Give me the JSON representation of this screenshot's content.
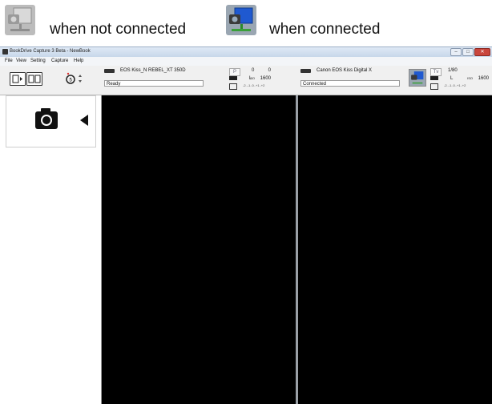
{
  "legend": {
    "not_connected": {
      "icon": "camera-not-connected-icon",
      "label": "when not connected"
    },
    "connected": {
      "icon": "camera-connected-icon",
      "label": "when connected"
    }
  },
  "window": {
    "title": "BookDrive Capture 3 Beta - NewBook",
    "buttons": {
      "minimize": "–",
      "maximize": "□",
      "close": "✕"
    }
  },
  "menu": [
    "File",
    "View",
    "Setting",
    "Capture",
    "Help"
  ],
  "cameras": [
    {
      "name": "EOS Kiss_N REBEL_XT 350D",
      "status": "Ready",
      "mode": "P",
      "value1": "0",
      "value2": "0",
      "quality": "L",
      "iso_label": "ISO",
      "iso": "1600",
      "scale": "-2..-1..0..+1..+2"
    },
    {
      "name": "Canon EOS Kiss Digital X",
      "status": "Connected",
      "mode": "Tv",
      "value1": "1/80",
      "quality": "L",
      "iso_label": "ISO",
      "iso": "1600",
      "scale": "-2..-1..0..+1..+2"
    }
  ],
  "colors": {
    "accent": "#2a6fd6",
    "view_bg": "#000000",
    "close_btn": "#c9463d"
  }
}
